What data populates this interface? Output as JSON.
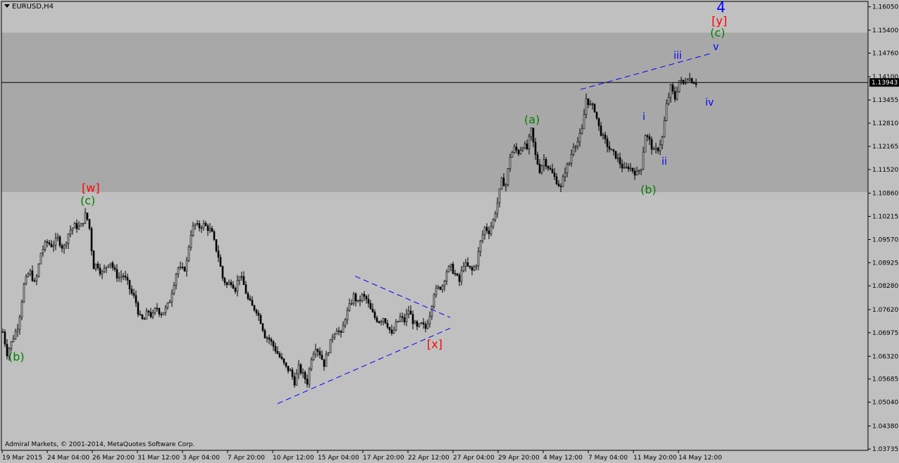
{
  "window": {
    "symbol": "EURUSD,H4"
  },
  "footer": {
    "copyright": "Admiral Markets, © 2001-2014, MetaQuotes Software Corp."
  },
  "colors": {
    "background": "#c0c0c0",
    "zone": "#a8a8a8",
    "candle": "#000000",
    "wave_green": "#008000",
    "wave_red": "#ff0000",
    "wave_blue": "#0000ff",
    "current_price_box": "#000000"
  },
  "chart_data": {
    "type": "candlestick",
    "symbol": "EURUSD",
    "timeframe": "H4",
    "ylim": [
      1.037,
      1.162
    ],
    "y_ticks": [
      "1.16050",
      "1.15400",
      "1.14760",
      "1.14100",
      "1.13455",
      "1.12810",
      "1.12165",
      "1.11520",
      "1.10860",
      "1.10215",
      "1.09570",
      "1.08925",
      "1.08280",
      "1.07620",
      "1.06975",
      "1.06320",
      "1.05685",
      "1.05040",
      "1.04380",
      "1.03735"
    ],
    "x_ticks": [
      "19 Mar 2015",
      "24 Mar 04:00",
      "26 Mar 20:00",
      "31 Mar 12:00",
      "3 Apr 04:00",
      "7 Apr 20:00",
      "10 Apr 12:00",
      "15 Apr 04:00",
      "17 Apr 20:00",
      "22 Apr 12:00",
      "27 Apr 04:00",
      "29 Apr 20:00",
      "4 May 12:00",
      "7 May 04:00",
      "11 May 20:00",
      "14 May 12:00"
    ],
    "current_price": "1.13943",
    "resistance_zone": [
      1.1089,
      1.1533
    ],
    "close_path": [
      [
        0,
        1.07
      ],
      [
        6,
        1.064
      ],
      [
        14,
        1.068
      ],
      [
        22,
        1.072
      ],
      [
        30,
        1.083
      ],
      [
        38,
        1.087
      ],
      [
        46,
        1.083
      ],
      [
        54,
        1.092
      ],
      [
        62,
        1.095
      ],
      [
        70,
        1.094
      ],
      [
        78,
        1.096
      ],
      [
        86,
        1.093
      ],
      [
        94,
        1.098
      ],
      [
        102,
        1.0995
      ],
      [
        110,
        1.099
      ],
      [
        118,
        1.103
      ],
      [
        124,
        1.098
      ],
      [
        128,
        1.088
      ],
      [
        134,
        1.089
      ],
      [
        140,
        1.086
      ],
      [
        146,
        1.088
      ],
      [
        152,
        1.09
      ],
      [
        158,
        1.087
      ],
      [
        164,
        1.085
      ],
      [
        170,
        1.086
      ],
      [
        176,
        1.084
      ],
      [
        182,
        1.081
      ],
      [
        188,
        1.079
      ],
      [
        194,
        1.074
      ],
      [
        200,
        1.073
      ],
      [
        206,
        1.076
      ],
      [
        212,
        1.074
      ],
      [
        218,
        1.077
      ],
      [
        224,
        1.075
      ],
      [
        230,
        1.076
      ],
      [
        236,
        1.078
      ],
      [
        242,
        1.083
      ],
      [
        248,
        1.088
      ],
      [
        254,
        1.087
      ],
      [
        260,
        1.088
      ],
      [
        266,
        1.097
      ],
      [
        272,
        1.1
      ],
      [
        278,
        1.099
      ],
      [
        284,
        1.1
      ],
      [
        290,
        1.099
      ],
      [
        296,
        1.098
      ],
      [
        300,
        1.095
      ],
      [
        306,
        1.091
      ],
      [
        312,
        1.085
      ],
      [
        318,
        1.083
      ],
      [
        324,
        1.084
      ],
      [
        330,
        1.082
      ],
      [
        336,
        1.086
      ],
      [
        342,
        1.083
      ],
      [
        348,
        1.079
      ],
      [
        354,
        1.077
      ],
      [
        360,
        1.076
      ],
      [
        366,
        1.073
      ],
      [
        372,
        1.069
      ],
      [
        378,
        1.068
      ],
      [
        384,
        1.066
      ],
      [
        390,
        1.064
      ],
      [
        396,
        1.062
      ],
      [
        402,
        1.06
      ],
      [
        408,
        1.059
      ],
      [
        414,
        1.056
      ],
      [
        420,
        1.06
      ],
      [
        426,
        1.058
      ],
      [
        432,
        1.056
      ],
      [
        438,
        1.063
      ],
      [
        444,
        1.066
      ],
      [
        450,
        1.064
      ],
      [
        456,
        1.061
      ],
      [
        462,
        1.065
      ],
      [
        468,
        1.069
      ],
      [
        474,
        1.071
      ],
      [
        480,
        1.069
      ],
      [
        486,
        1.074
      ],
      [
        492,
        1.077
      ],
      [
        498,
        1.08
      ],
      [
        504,
        1.078
      ],
      [
        510,
        1.08
      ],
      [
        516,
        1.079
      ],
      [
        522,
        1.076
      ],
      [
        528,
        1.074
      ],
      [
        534,
        1.073
      ],
      [
        540,
        1.074
      ],
      [
        546,
        1.072
      ],
      [
        552,
        1.069
      ],
      [
        558,
        1.072
      ],
      [
        564,
        1.074
      ],
      [
        570,
        1.073
      ],
      [
        576,
        1.076
      ],
      [
        582,
        1.073
      ],
      [
        588,
        1.071
      ],
      [
        594,
        1.072
      ],
      [
        600,
        1.071
      ],
      [
        606,
        1.075
      ],
      [
        612,
        1.081
      ],
      [
        618,
        1.082
      ],
      [
        624,
        1.083
      ],
      [
        630,
        1.087
      ],
      [
        636,
        1.088
      ],
      [
        642,
        1.086
      ],
      [
        648,
        1.084
      ],
      [
        654,
        1.089
      ],
      [
        660,
        1.088
      ],
      [
        666,
        1.087
      ],
      [
        672,
        1.089
      ],
      [
        678,
        1.095
      ],
      [
        684,
        1.099
      ],
      [
        690,
        1.098
      ],
      [
        696,
        1.101
      ],
      [
        702,
        1.106
      ],
      [
        708,
        1.112
      ],
      [
        714,
        1.111
      ],
      [
        720,
        1.119
      ],
      [
        726,
        1.121
      ],
      [
        732,
        1.12
      ],
      [
        738,
        1.122
      ],
      [
        744,
        1.121
      ],
      [
        750,
        1.126
      ],
      [
        756,
        1.119
      ],
      [
        762,
        1.115
      ],
      [
        768,
        1.118
      ],
      [
        774,
        1.116
      ],
      [
        780,
        1.114
      ],
      [
        786,
        1.112
      ],
      [
        792,
        1.11
      ],
      [
        798,
        1.115
      ],
      [
        804,
        1.117
      ],
      [
        810,
        1.122
      ],
      [
        816,
        1.123
      ],
      [
        822,
        1.126
      ],
      [
        828,
        1.135
      ],
      [
        834,
        1.133
      ],
      [
        840,
        1.132
      ],
      [
        846,
        1.127
      ],
      [
        852,
        1.124
      ],
      [
        858,
        1.122
      ],
      [
        864,
        1.12
      ],
      [
        870,
        1.119
      ],
      [
        876,
        1.117
      ],
      [
        882,
        1.115
      ],
      [
        888,
        1.116
      ],
      [
        894,
        1.115
      ],
      [
        900,
        1.114
      ],
      [
        906,
        1.116
      ],
      [
        912,
        1.125
      ],
      [
        918,
        1.123
      ],
      [
        924,
        1.12
      ],
      [
        930,
        1.121
      ],
      [
        936,
        1.124
      ],
      [
        942,
        1.133
      ],
      [
        948,
        1.138
      ],
      [
        954,
        1.135
      ],
      [
        960,
        1.14
      ],
      [
        966,
        1.139
      ],
      [
        972,
        1.141
      ],
      [
        978,
        1.14
      ],
      [
        984,
        1.1394
      ]
    ],
    "annotations": [
      {
        "text": "(b)",
        "color": "green",
        "x": 8,
        "y": 1.062
      },
      {
        "text": "[w]",
        "color": "red",
        "x": 112,
        "y": 1.109
      },
      {
        "text": "(c)",
        "color": "green",
        "x": 110,
        "y": 1.1055
      },
      {
        "text": "[x]",
        "color": "red",
        "x": 602,
        "y": 1.0655
      },
      {
        "text": "(a)",
        "color": "green",
        "x": 740,
        "y": 1.128
      },
      {
        "text": "(b)",
        "color": "green",
        "x": 905,
        "y": 1.1085
      },
      {
        "text": "i",
        "color": "blue",
        "x": 908,
        "y": 1.129
      },
      {
        "text": "ii",
        "color": "blue",
        "x": 935,
        "y": 1.1165
      },
      {
        "text": "iii",
        "color": "blue",
        "x": 952,
        "y": 1.146
      },
      {
        "text": "iv",
        "color": "blue",
        "x": 997,
        "y": 1.133
      },
      {
        "text": "v",
        "color": "blue",
        "x": 1008,
        "y": 1.1485
      },
      {
        "text": "(c)",
        "color": "green",
        "x": 1004,
        "y": 1.1522
      },
      {
        "text": "[y]",
        "color": "red",
        "x": 1006,
        "y": 1.1555
      },
      {
        "text": "4",
        "color": "blue",
        "x": 1013,
        "y": 1.159
      }
    ],
    "trendlines": [
      [
        [
          390,
          1.05
        ],
        [
          635,
          1.071
        ]
      ],
      [
        [
          500,
          1.0855
        ],
        [
          635,
          1.074
        ]
      ],
      [
        [
          820,
          1.1375
        ],
        [
          1005,
          1.1475
        ]
      ]
    ]
  }
}
